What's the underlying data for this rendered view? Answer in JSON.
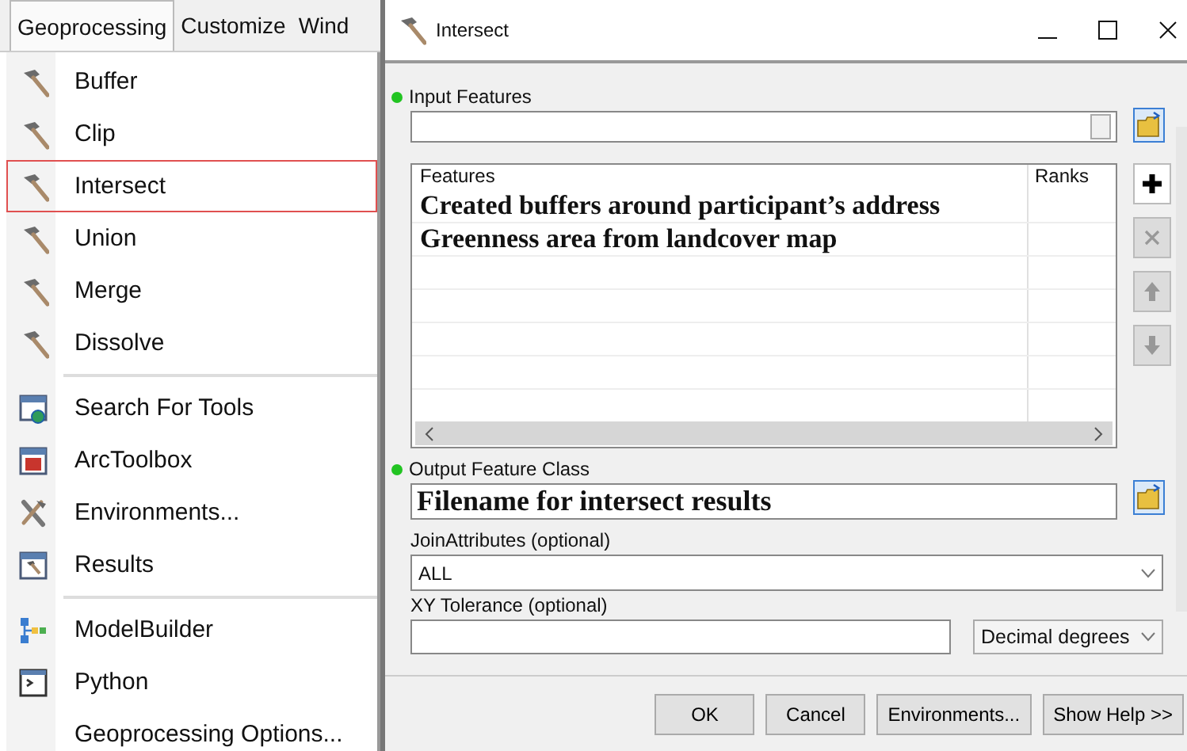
{
  "menubar": {
    "tabs": [
      {
        "label": "Geoprocessing",
        "selected": true
      },
      {
        "label": "Customize",
        "selected": false
      },
      {
        "label": "Wind",
        "selected": false
      }
    ]
  },
  "menu": {
    "groups": [
      {
        "items": [
          {
            "kind": "tool",
            "label": "Buffer",
            "selected": false
          },
          {
            "kind": "tool",
            "label": "Clip",
            "selected": false
          },
          {
            "kind": "tool",
            "label": "Intersect",
            "selected": true
          },
          {
            "kind": "tool",
            "label": "Union",
            "selected": false
          },
          {
            "kind": "tool",
            "label": "Merge",
            "selected": false
          },
          {
            "kind": "tool",
            "label": "Dissolve",
            "selected": false
          }
        ]
      },
      {
        "items": [
          {
            "kind": "search",
            "label": "Search For Tools",
            "selected": false
          },
          {
            "kind": "toolbox",
            "label": "ArcToolbox",
            "selected": false
          },
          {
            "kind": "environments",
            "label": "Environments...",
            "selected": false
          },
          {
            "kind": "results",
            "label": "Results",
            "selected": false
          }
        ]
      },
      {
        "items": [
          {
            "kind": "modelbuilder",
            "label": "ModelBuilder",
            "selected": false
          },
          {
            "kind": "python",
            "label": "Python",
            "selected": false
          },
          {
            "kind": "none",
            "label": "Geoprocessing Options...",
            "selected": false
          }
        ]
      }
    ]
  },
  "dialog": {
    "title": "Intersect",
    "input_features": {
      "label": "Input Features",
      "required": true
    },
    "features_table": {
      "columns": [
        "Features",
        "Ranks"
      ],
      "rows": [
        {
          "feature": "Created buffers around participant’s address"
        },
        {
          "feature": "Greenness area from landcover map"
        }
      ]
    },
    "list_buttons": [
      {
        "kind": "add",
        "disabled": false
      },
      {
        "kind": "remove",
        "disabled": true
      },
      {
        "kind": "up",
        "disabled": true
      },
      {
        "kind": "down",
        "disabled": true
      }
    ],
    "output_feature_class": {
      "label": "Output Feature Class",
      "required": true,
      "value": "Filename for intersect results"
    },
    "join_attributes": {
      "label": "JoinAttributes (optional)",
      "value": "ALL"
    },
    "xy_tolerance": {
      "label": "XY Tolerance (optional)",
      "unit": "Decimal degrees"
    },
    "buttons": [
      "OK",
      "Cancel",
      "Environments...",
      "Show Help >>"
    ]
  }
}
